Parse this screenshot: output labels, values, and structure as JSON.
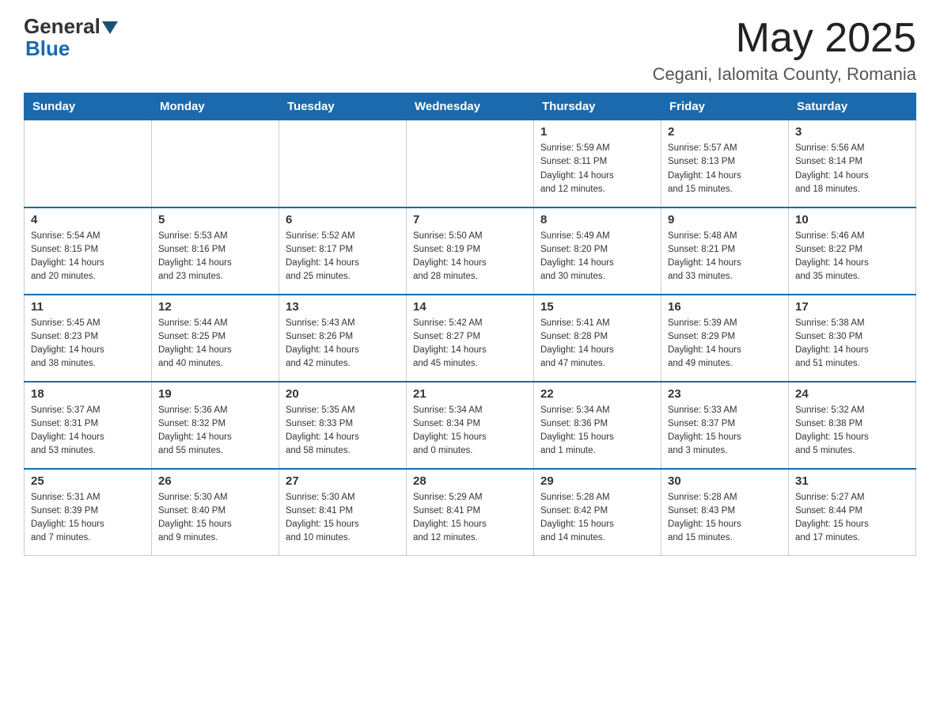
{
  "header": {
    "logo_general": "General",
    "logo_blue": "Blue",
    "month_year": "May 2025",
    "location": "Cegani, Ialomita County, Romania"
  },
  "days_of_week": [
    "Sunday",
    "Monday",
    "Tuesday",
    "Wednesday",
    "Thursday",
    "Friday",
    "Saturday"
  ],
  "weeks": [
    [
      {
        "day": "",
        "info": ""
      },
      {
        "day": "",
        "info": ""
      },
      {
        "day": "",
        "info": ""
      },
      {
        "day": "",
        "info": ""
      },
      {
        "day": "1",
        "info": "Sunrise: 5:59 AM\nSunset: 8:11 PM\nDaylight: 14 hours\nand 12 minutes."
      },
      {
        "day": "2",
        "info": "Sunrise: 5:57 AM\nSunset: 8:13 PM\nDaylight: 14 hours\nand 15 minutes."
      },
      {
        "day": "3",
        "info": "Sunrise: 5:56 AM\nSunset: 8:14 PM\nDaylight: 14 hours\nand 18 minutes."
      }
    ],
    [
      {
        "day": "4",
        "info": "Sunrise: 5:54 AM\nSunset: 8:15 PM\nDaylight: 14 hours\nand 20 minutes."
      },
      {
        "day": "5",
        "info": "Sunrise: 5:53 AM\nSunset: 8:16 PM\nDaylight: 14 hours\nand 23 minutes."
      },
      {
        "day": "6",
        "info": "Sunrise: 5:52 AM\nSunset: 8:17 PM\nDaylight: 14 hours\nand 25 minutes."
      },
      {
        "day": "7",
        "info": "Sunrise: 5:50 AM\nSunset: 8:19 PM\nDaylight: 14 hours\nand 28 minutes."
      },
      {
        "day": "8",
        "info": "Sunrise: 5:49 AM\nSunset: 8:20 PM\nDaylight: 14 hours\nand 30 minutes."
      },
      {
        "day": "9",
        "info": "Sunrise: 5:48 AM\nSunset: 8:21 PM\nDaylight: 14 hours\nand 33 minutes."
      },
      {
        "day": "10",
        "info": "Sunrise: 5:46 AM\nSunset: 8:22 PM\nDaylight: 14 hours\nand 35 minutes."
      }
    ],
    [
      {
        "day": "11",
        "info": "Sunrise: 5:45 AM\nSunset: 8:23 PM\nDaylight: 14 hours\nand 38 minutes."
      },
      {
        "day": "12",
        "info": "Sunrise: 5:44 AM\nSunset: 8:25 PM\nDaylight: 14 hours\nand 40 minutes."
      },
      {
        "day": "13",
        "info": "Sunrise: 5:43 AM\nSunset: 8:26 PM\nDaylight: 14 hours\nand 42 minutes."
      },
      {
        "day": "14",
        "info": "Sunrise: 5:42 AM\nSunset: 8:27 PM\nDaylight: 14 hours\nand 45 minutes."
      },
      {
        "day": "15",
        "info": "Sunrise: 5:41 AM\nSunset: 8:28 PM\nDaylight: 14 hours\nand 47 minutes."
      },
      {
        "day": "16",
        "info": "Sunrise: 5:39 AM\nSunset: 8:29 PM\nDaylight: 14 hours\nand 49 minutes."
      },
      {
        "day": "17",
        "info": "Sunrise: 5:38 AM\nSunset: 8:30 PM\nDaylight: 14 hours\nand 51 minutes."
      }
    ],
    [
      {
        "day": "18",
        "info": "Sunrise: 5:37 AM\nSunset: 8:31 PM\nDaylight: 14 hours\nand 53 minutes."
      },
      {
        "day": "19",
        "info": "Sunrise: 5:36 AM\nSunset: 8:32 PM\nDaylight: 14 hours\nand 55 minutes."
      },
      {
        "day": "20",
        "info": "Sunrise: 5:35 AM\nSunset: 8:33 PM\nDaylight: 14 hours\nand 58 minutes."
      },
      {
        "day": "21",
        "info": "Sunrise: 5:34 AM\nSunset: 8:34 PM\nDaylight: 15 hours\nand 0 minutes."
      },
      {
        "day": "22",
        "info": "Sunrise: 5:34 AM\nSunset: 8:36 PM\nDaylight: 15 hours\nand 1 minute."
      },
      {
        "day": "23",
        "info": "Sunrise: 5:33 AM\nSunset: 8:37 PM\nDaylight: 15 hours\nand 3 minutes."
      },
      {
        "day": "24",
        "info": "Sunrise: 5:32 AM\nSunset: 8:38 PM\nDaylight: 15 hours\nand 5 minutes."
      }
    ],
    [
      {
        "day": "25",
        "info": "Sunrise: 5:31 AM\nSunset: 8:39 PM\nDaylight: 15 hours\nand 7 minutes."
      },
      {
        "day": "26",
        "info": "Sunrise: 5:30 AM\nSunset: 8:40 PM\nDaylight: 15 hours\nand 9 minutes."
      },
      {
        "day": "27",
        "info": "Sunrise: 5:30 AM\nSunset: 8:41 PM\nDaylight: 15 hours\nand 10 minutes."
      },
      {
        "day": "28",
        "info": "Sunrise: 5:29 AM\nSunset: 8:41 PM\nDaylight: 15 hours\nand 12 minutes."
      },
      {
        "day": "29",
        "info": "Sunrise: 5:28 AM\nSunset: 8:42 PM\nDaylight: 15 hours\nand 14 minutes."
      },
      {
        "day": "30",
        "info": "Sunrise: 5:28 AM\nSunset: 8:43 PM\nDaylight: 15 hours\nand 15 minutes."
      },
      {
        "day": "31",
        "info": "Sunrise: 5:27 AM\nSunset: 8:44 PM\nDaylight: 15 hours\nand 17 minutes."
      }
    ]
  ]
}
